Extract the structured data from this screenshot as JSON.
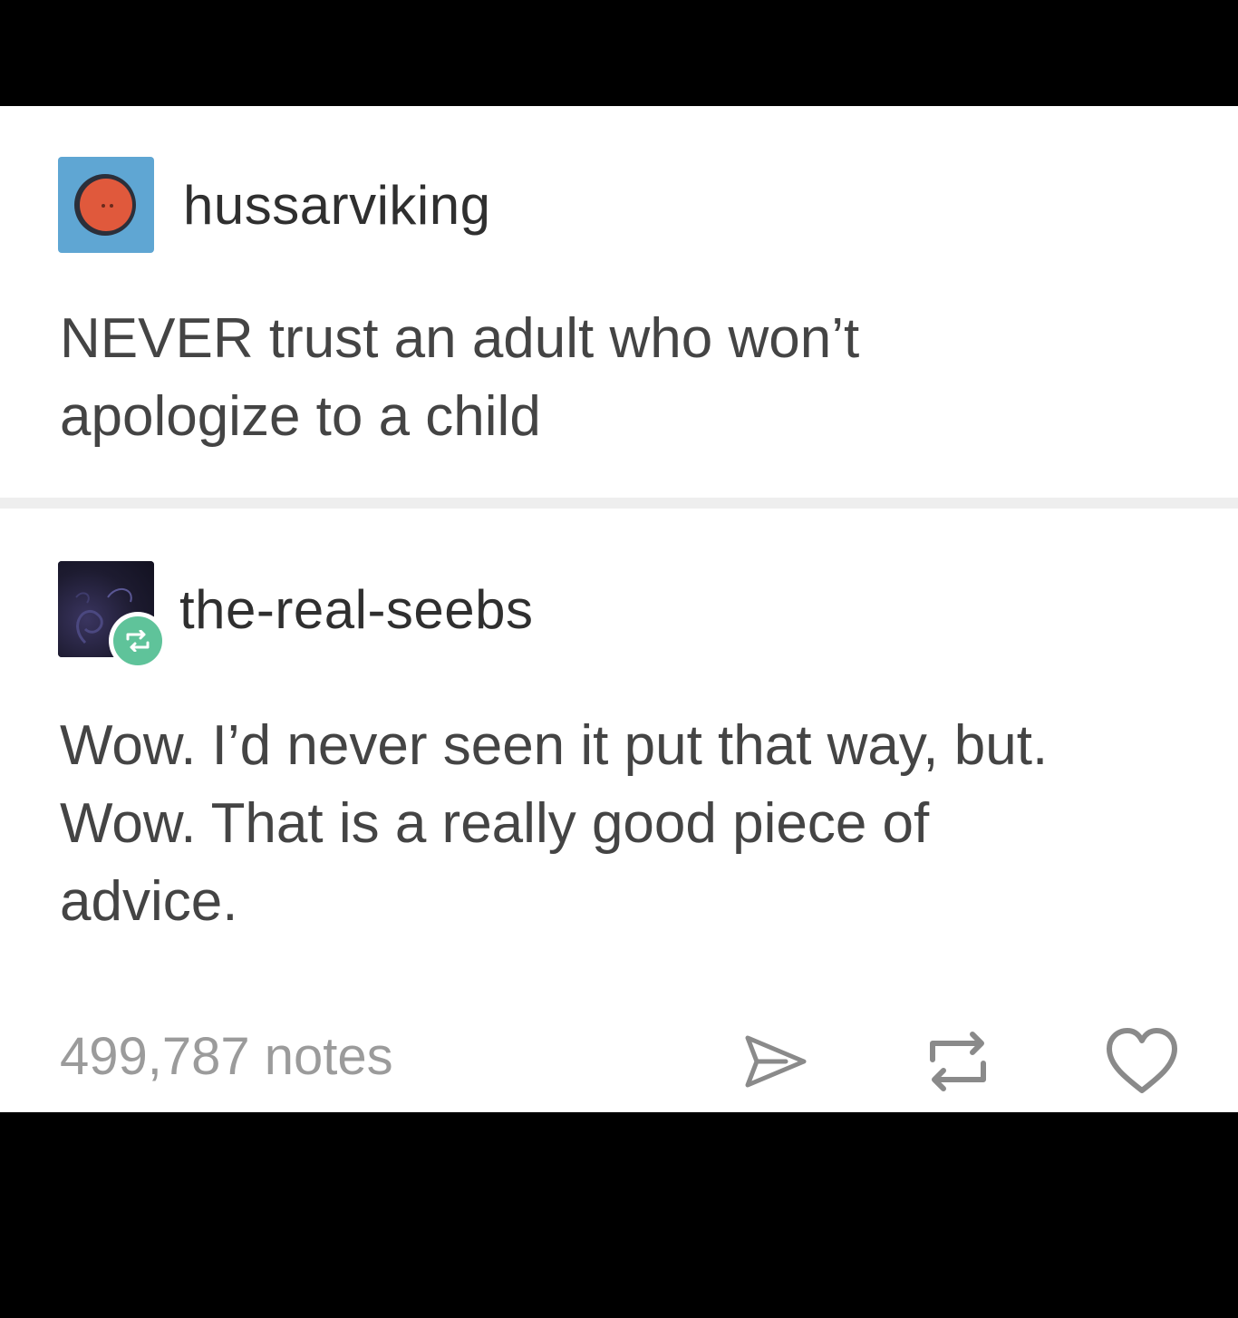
{
  "posts": [
    {
      "username": "hussarviking",
      "avatar": "hussarviking-avatar",
      "text": "NEVER trust an adult who won’t apologize to a child"
    },
    {
      "username": "the-real-seebs",
      "avatar": "the-real-seebs-avatar",
      "reblog_badge": "reblog-icon",
      "text_lines": [
        "Wow. I’d never seen it put that way, but.",
        "Wow. That is a really good piece of",
        "advice."
      ]
    }
  ],
  "footer": {
    "notes": "499,787 notes",
    "actions": [
      "share-icon",
      "reblog-icon",
      "heart-icon"
    ]
  },
  "colors": {
    "background": "#000000",
    "card": "#ffffff",
    "divider": "#eeeeee",
    "text": "#444444",
    "muted": "#9b9b9b",
    "reblog_green": "#5fc39a",
    "avatar_blue": "#5fa6d3",
    "avatar_orange": "#e0593c"
  }
}
